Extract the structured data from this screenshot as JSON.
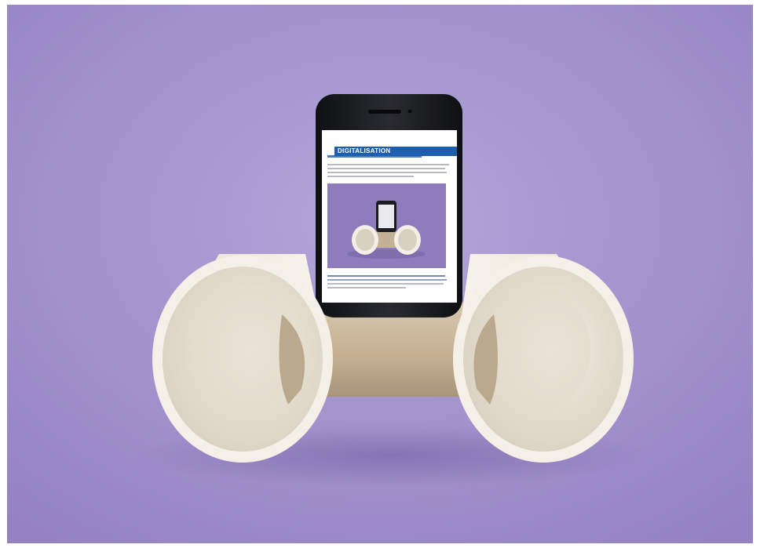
{
  "photo": {
    "subject": "phone-speaker-from-cups-and-tube",
    "colors": {
      "backdrop": "#9d8cc8",
      "backdrop_light": "#b4a6d8",
      "cup": "#f3efe6",
      "cup_shadow": "#d8d1c2",
      "tube": "#c9b79b",
      "phone_body": "#1b1c20",
      "screen_bg": "#ffffff",
      "screen_accent": "#1c5fae"
    }
  },
  "phone_screen": {
    "heading": "DIGITALISATION"
  }
}
